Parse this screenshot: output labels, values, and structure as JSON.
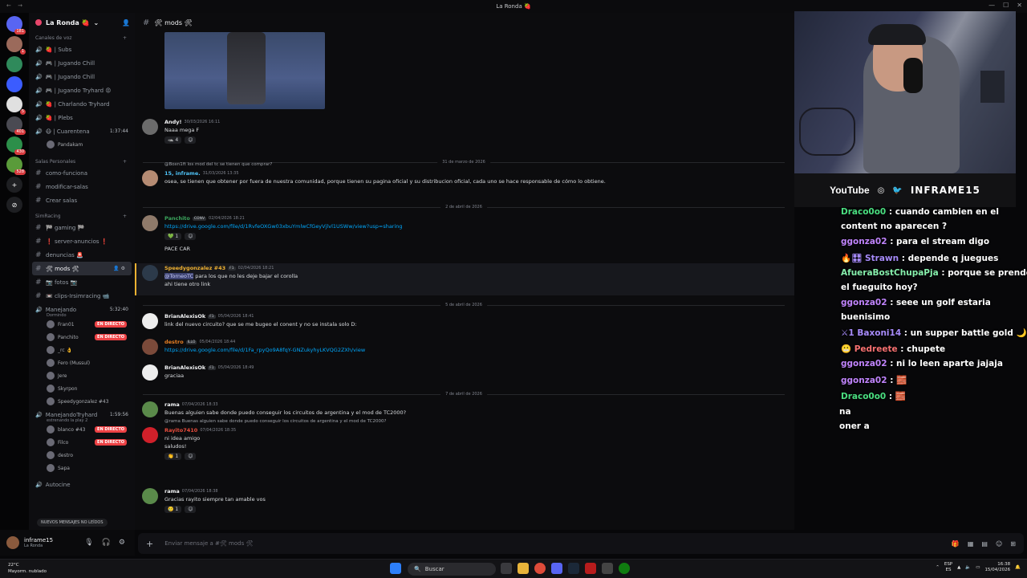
{
  "window": {
    "title": "La Ronda 🍓",
    "nav": "← →"
  },
  "servers": [
    {
      "name": "home",
      "badge": "181",
      "color": "#5865f2"
    },
    {
      "name": "server-a",
      "badge": "1",
      "color": "#9b6a5b"
    },
    {
      "name": "la-ronda",
      "badge": "",
      "color": "#2f8a5b"
    },
    {
      "name": "folder",
      "badge": "",
      "color": "#3b5cff"
    },
    {
      "name": "server-b",
      "badge": "5",
      "color": "#e0e0e0"
    },
    {
      "name": "server-c",
      "badge": "401",
      "color": "#4a4a52"
    },
    {
      "name": "server-d",
      "badge": "430",
      "color": "#2c8f4a"
    },
    {
      "name": "server-e",
      "badge": "528",
      "color": "#5a9b3a"
    },
    {
      "name": "add-server",
      "badge": "",
      "color": "#1e1f22"
    },
    {
      "name": "discover",
      "badge": "",
      "color": "#1e1f22"
    }
  ],
  "server": {
    "name": "La Ronda 🍓"
  },
  "sidebar": {
    "voice_category": "Canales de voz",
    "voice_channels": [
      {
        "name": "🍓 | Subs",
        "extra": ""
      },
      {
        "name": "🎮 | Jugando Chill",
        "extra": ""
      },
      {
        "name": "🎮 | Jugando Chill",
        "extra": ""
      },
      {
        "name": "🎮 | Jugando Tryhard 😡",
        "extra": ""
      },
      {
        "name": "🍓 | Charlando Tryhard",
        "extra": ""
      },
      {
        "name": "🍓 | Plebs",
        "extra": ""
      },
      {
        "name": "😷 | Cuarentena",
        "extra": "1:37:44"
      }
    ],
    "cuarentena_member": "Pandakam",
    "salas_category": "Salas Personales",
    "salas_channels": [
      {
        "name": "como-funciona"
      },
      {
        "name": "modificar-salas"
      },
      {
        "name": "Crear salas"
      }
    ],
    "simracing_category": "SimRacing",
    "simracing_channels": [
      {
        "name": "🏁 gaming 🏁",
        "active": false
      },
      {
        "name": "❗ server-anuncios ❗",
        "active": false
      },
      {
        "name": "denuncias 🚨",
        "active": false
      },
      {
        "name": "🛠 mods 🛠",
        "active": true
      },
      {
        "name": "📷 fotos 📷",
        "active": false
      },
      {
        "name": "📼 clips-Irsimracing 📹",
        "active": false
      }
    ],
    "manejando": {
      "name": "Manejando",
      "time": "5:32:40",
      "status": "Dormindo"
    },
    "manejando_members": [
      {
        "name": "Fran01",
        "live": true
      },
      {
        "name": "Panchito",
        "live": true
      },
      {
        "name": "_rc 👌",
        "live": false
      },
      {
        "name": "Fero (Mussul)",
        "live": false
      },
      {
        "name": "Jere",
        "live": false
      },
      {
        "name": "Skyrpon",
        "live": false
      },
      {
        "name": "Speedygonzalez #43",
        "live": false
      }
    ],
    "manejando_tryhard": {
      "name": "ManejandoTryhard",
      "time": "1:59:56",
      "status": "estrenando la play 2"
    },
    "tryhard_members": [
      {
        "name": "blanco #43",
        "live": true
      },
      {
        "name": "Filco",
        "live": true
      },
      {
        "name": "destro",
        "live": false
      },
      {
        "name": "Sapa",
        "live": false
      }
    ],
    "autocine": "Autocine",
    "live_label": "EN DIRECTO",
    "new_messages": "NUEVOS MENSAJES NO LEÍDOS"
  },
  "user": {
    "name": "inframe15",
    "status": "La Ronda"
  },
  "channel": {
    "name": "🛠 mods 🛠"
  },
  "messages": [
    {
      "author": "Andy!",
      "color": "#f2f3f5",
      "ts": "30/03/2026 16:11",
      "lines": [
        "Naaa mega F"
      ],
      "reacts": [
        "🦡 4",
        "☺"
      ],
      "av": "#6b6b6b"
    },
    {
      "author": "15, inframe.",
      "color": "#4fc3f7",
      "ts": "31/03/2026 13:35",
      "reply": "@Boxn1ft los mod del tc se tienen que comprar?",
      "lines": [
        "osea, se tienen que obtener por fuera de nuestra comunidad, porque tienen su pagina oficial y su distribucion oficial, cada uno se hace responsable de cómo lo obtiene."
      ],
      "av": "#b58b73"
    },
    {
      "author": "Panchito",
      "color": "#3ba55d",
      "tag": "CONV",
      "ts": "02/04/2026 18:21",
      "link": "https://drive.google.com/file/d/1RvfeOXGw03xbuYmlwCfGeyVjlvl1USWw/view?usp=sharing",
      "lines2": [
        "PACE CAR"
      ],
      "reacts": [
        "💚 1",
        "☺"
      ],
      "av": "#8f7a6a"
    },
    {
      "author": "Speedygonzalez #43",
      "color": "#f0b232",
      "tag": "F1",
      "ts": "02/04/2026 18:21",
      "mention": "@TorneoTC",
      "lines": [
        "para los que no les deje bajar el corolla",
        "ahi tiene otro link"
      ],
      "av": "#2c3a4a"
    },
    {
      "author": "BrianAlexisOk",
      "color": "#f2f3f5",
      "tag": "F1",
      "ts": "05/04/2026 18:41",
      "lines": [
        "link del nuevo circuito? que se me bugeo el conent y no se instala solo D:"
      ],
      "av": "#eeeeee"
    },
    {
      "author": "destro",
      "color": "#e67e22",
      "tag": "ILLO",
      "ts": "05/04/2026 18:44",
      "link": "https://drive.google.com/file/d/1Fa_rpyQo9A8fqY-GNZukyhyLKVQG2ZXh/view",
      "av": "#7b4a3a"
    },
    {
      "author": "BrianAlexisOk",
      "color": "#f2f3f5",
      "tag": "F1",
      "ts": "05/04/2026 18:49",
      "lines": [
        "graciaa"
      ],
      "av": "#eeeeee"
    },
    {
      "author": "rama",
      "color": "#f2f3f5",
      "ts": "07/04/2026 18:33",
      "lines": [
        "Buenas alguien sabe donde puedo conseguir los circuitos de argentina y el mod de TC2000?"
      ],
      "av": "#5a8a4a"
    },
    {
      "author": "Rayito7410",
      "color": "#e74c3c",
      "ts": "07/04/2026 18:35",
      "reply": "@rama Buenas alguien sabe donde puedo conseguir los circuitos de argentina y el mod de TC2000?",
      "lines": [
        "ni idea amigo",
        "saludos!"
      ],
      "reacts": [
        "👏 1",
        "☺"
      ],
      "av": "#d0202a"
    },
    {
      "author": "rama",
      "color": "#f2f3f5",
      "ts": "07/04/2026 18:38",
      "lines": [
        "Gracias rayito siempre tan amable vos"
      ],
      "reacts": [
        "🥲 1",
        "☺"
      ],
      "av": "#5a8a4a"
    }
  ],
  "dividers": [
    "31 de marzo de 2026",
    "2 de abril de 2026",
    "5 de abril de 2026",
    "7 de abril de 2026"
  ],
  "compose": {
    "placeholder": "Enviar mensaje a #🛠 mods 🛠"
  },
  "stream": {
    "socials": {
      "youtube": "YouTube",
      "handle": "INFRAME15"
    },
    "chat": [
      {
        "user": "Draco0o0",
        "color": "#4ade80",
        "text": ": cuando cambien en el"
      },
      {
        "user": "",
        "color": "#ffffff",
        "text": "content no aparecen ?"
      },
      {
        "user": "ggonza02",
        "color": "#c084fc",
        "text": ": para el stream digo"
      },
      {
        "user": "🔥🎛 Strawn",
        "color": "#a78bfa",
        "text": ": depende q juegues"
      },
      {
        "user": "AfueraBostChupaPja",
        "color": "#86efac",
        "text": ": porque se prende"
      },
      {
        "user": "",
        "color": "#ffffff",
        "text": "el fueguito hoy?"
      },
      {
        "user": "ggonza02",
        "color": "#c084fc",
        "text": ": seee un golf estaria"
      },
      {
        "user": "",
        "color": "#ffffff",
        "text": "buenisimo"
      },
      {
        "user": "⚔1 Baxoni14",
        "color": "#a78bfa",
        "text": ": un supper battle gold 🌙"
      },
      {
        "user": "😬 Pedreete",
        "color": "#f87171",
        "text": ": chupete"
      },
      {
        "user": "ggonza02",
        "color": "#c084fc",
        "text": ": ni lo leen aparte jajaja"
      },
      {
        "user": "ggonza02",
        "color": "#c084fc",
        "text": ": 🧱"
      },
      {
        "user": "Draco0o0",
        "color": "#4ade80",
        "text": ": 🧱"
      },
      {
        "user": "",
        "color": "#ffffff",
        "text": "na"
      },
      {
        "user": "",
        "color": "#ffffff",
        "text": "oner a"
      }
    ]
  },
  "taskbar": {
    "weather_temp": "22°C",
    "weather_desc": "Mayorm. nublado",
    "search": "Buscar",
    "lang": "ESP",
    "lang2": "ES",
    "time": "16:38",
    "date": "15/04/2026"
  }
}
